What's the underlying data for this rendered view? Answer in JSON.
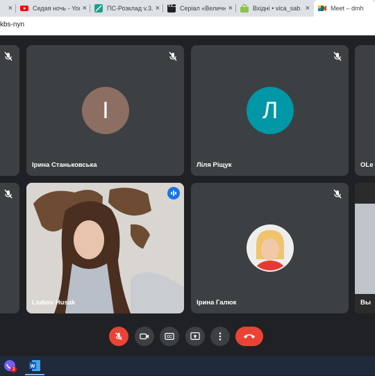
{
  "browser": {
    "tabs": [
      {
        "title": "",
        "icon": "partial-tab"
      },
      {
        "title": "Седая ночь - You",
        "icon": "youtube-icon"
      },
      {
        "title": "ПС-Розклад v.3.0",
        "icon": "sheet-icon"
      },
      {
        "title": "Серіал «Величн",
        "icon": "clapper-icon"
      },
      {
        "title": "Вхідні • vica_sab",
        "icon": "mail-icon"
      },
      {
        "title": "Meet – dmh",
        "icon": "meet-icon"
      }
    ],
    "url": "kbs-nyn"
  },
  "participants": [
    {
      "name": "Ірина Станьковська",
      "initial": "І",
      "avatar_color": "#8d6e63"
    },
    {
      "name": "Ліля Ріщук",
      "initial": "Л",
      "avatar_color": "#0097a7"
    },
    {
      "name": "OLe",
      "initial": ""
    },
    {
      "name": "Liubov Husak",
      "initial": ""
    },
    {
      "name": "Ірина Галюк",
      "initial": ""
    },
    {
      "name": "Вы",
      "initial": ""
    }
  ],
  "controls": [
    "mic-off",
    "camera",
    "captions",
    "present",
    "more",
    "end-call"
  ],
  "taskbar": {
    "badge_count": "3"
  },
  "colors": {
    "accent": "#1a73e8",
    "danger": "#ea4335",
    "tile": "#3c4043",
    "background": "#202124"
  }
}
